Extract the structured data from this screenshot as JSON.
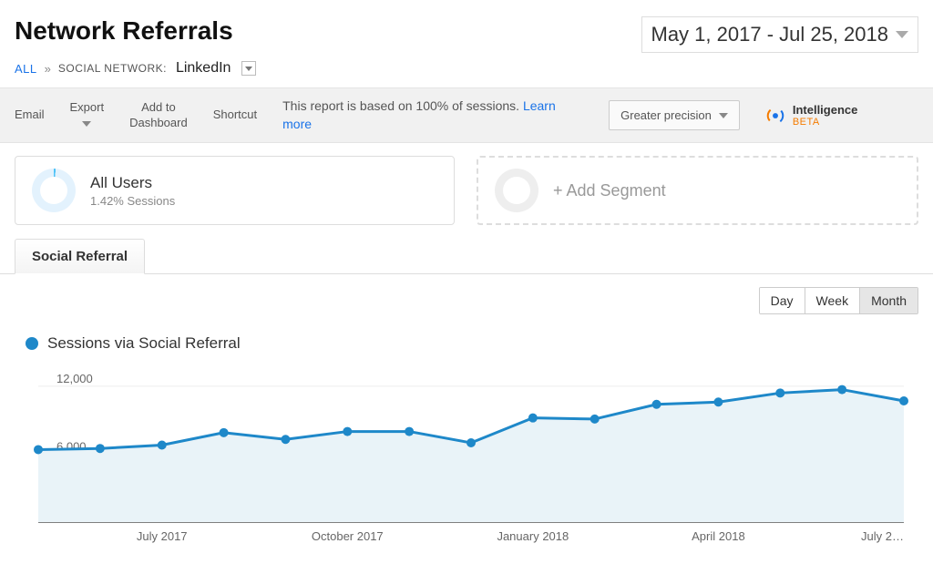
{
  "header": {
    "title": "Network Referrals",
    "date_range": "May 1, 2017 - Jul 25, 2018"
  },
  "breadcrumb": {
    "all": "ALL",
    "label": "SOCIAL NETWORK:",
    "value": "LinkedIn"
  },
  "toolbar": {
    "email": "Email",
    "export": "Export",
    "add_to_dashboard_l1": "Add to",
    "add_to_dashboard_l2": "Dashboard",
    "shortcut": "Shortcut",
    "report_note_a": "This report is based on 100% of sessions. ",
    "report_note_link": "Learn more",
    "precision": "Greater precision",
    "intelligence": "Intelligence",
    "beta": "BETA"
  },
  "segments": {
    "all_users_title": "All Users",
    "all_users_sub": "1.42% Sessions",
    "add_segment": "+ Add Segment"
  },
  "tabs": {
    "social_referral": "Social Referral"
  },
  "granularity": {
    "day": "Day",
    "week": "Week",
    "month": "Month",
    "active": "month"
  },
  "legend": {
    "series_name": "Sessions via Social Referral"
  },
  "chart_data": {
    "type": "line",
    "title": "",
    "xlabel": "",
    "ylabel": "",
    "ylim": [
      0,
      14000
    ],
    "y_ticks": [
      6000,
      12000
    ],
    "x_tick_labels": [
      "July 2017",
      "October 2017",
      "January 2018",
      "April 2018",
      "July 2…"
    ],
    "categories": [
      "May 2017",
      "Jun 2017",
      "Jul 2017",
      "Aug 2017",
      "Sep 2017",
      "Oct 2017",
      "Nov 2017",
      "Dec 2017",
      "Jan 2018",
      "Feb 2018",
      "Mar 2018",
      "Apr 2018",
      "May 2018",
      "Jun 2018",
      "Jul 2018"
    ],
    "series": [
      {
        "name": "Sessions via Social Referral",
        "values": [
          6400,
          6500,
          6800,
          7900,
          7300,
          8000,
          8000,
          7000,
          9200,
          9100,
          10400,
          10600,
          11400,
          11700,
          10700
        ]
      }
    ]
  }
}
